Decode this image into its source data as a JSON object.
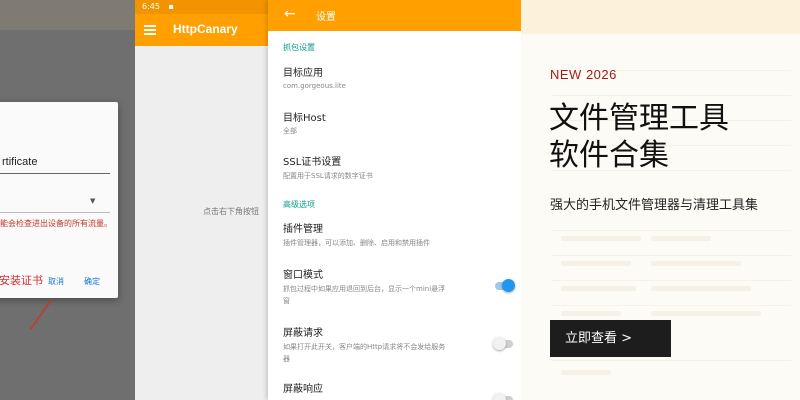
{
  "dialog": {
    "name_value": "rtificate",
    "warning": "能会检查进出设备的所有流量。",
    "install_label": "安装证书",
    "cancel_label": "取消",
    "ok_label": "确定"
  },
  "main_screen": {
    "status_time": "6:45",
    "app_title": "HttpCanary",
    "hint": "点击右下角按钮"
  },
  "settings": {
    "back_icon": "arrow-left-icon",
    "title": "设置",
    "sections": [
      {
        "label": "抓包设置"
      },
      {
        "label": "高级选项"
      }
    ],
    "items": [
      {
        "title": "目标应用",
        "subtitle": "com.gorgeous.lite"
      },
      {
        "title": "目标Host",
        "subtitle": "全部"
      },
      {
        "title": "SSL证书设置",
        "subtitle": "配置用于SSL请求的数字证书"
      },
      {
        "title": "插件管理",
        "subtitle": "插件管理器，可以添加、删除、启用和禁用插件"
      },
      {
        "title": "窗口模式",
        "subtitle": "抓包过程中如果应用退回到后台，显示一个mini悬浮",
        "subtitle2": "窗",
        "toggle": "on"
      },
      {
        "title": "屏蔽请求",
        "subtitle": "如果打开此开关，客户端的Http请求将不会发给服务",
        "subtitle2": "器",
        "toggle": "off"
      },
      {
        "title": "屏蔽响应",
        "toggle": "off"
      }
    ]
  },
  "promo": {
    "tag": "NEW 2026",
    "title": "文件管理工具软件合集",
    "description": "强大的手机文件管理器与清理工具集",
    "button_label": "立即查看 >"
  },
  "colors": {
    "accent_orange": "#ffa000",
    "section_teal": "#0a9c8a",
    "toggle_on": "#2196f3",
    "promo_tag_red": "#a8191b",
    "button_dark": "#1d1d1d"
  }
}
